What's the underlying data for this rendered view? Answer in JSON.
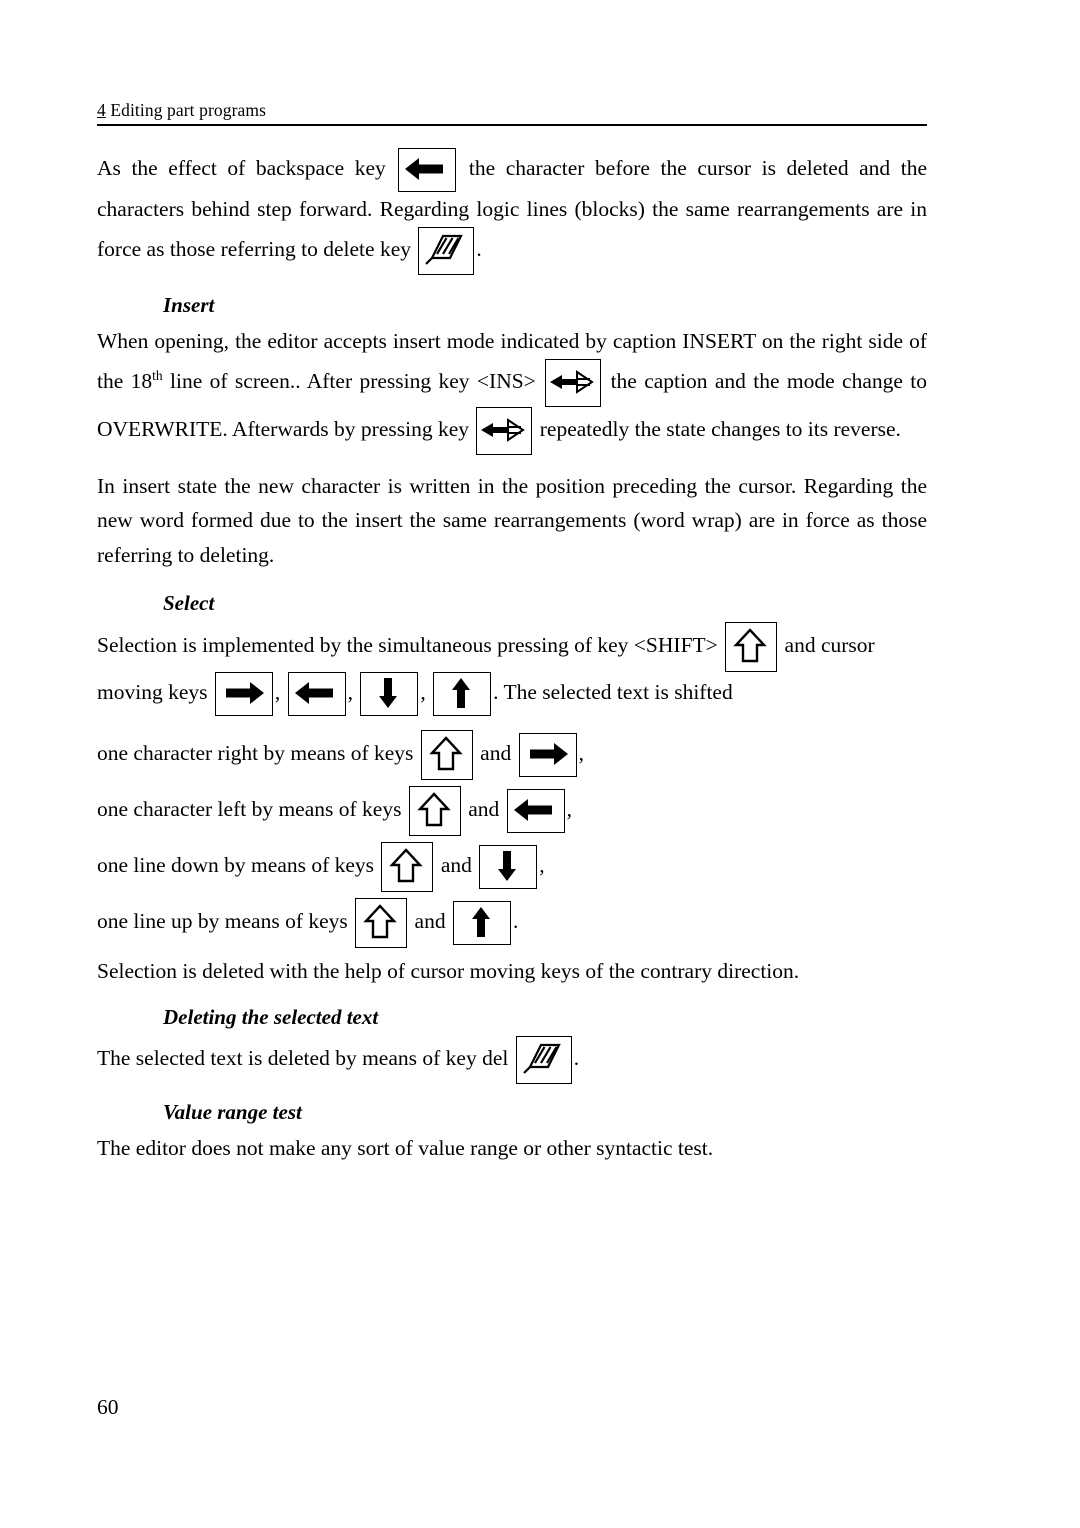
{
  "header": {
    "chapter_number": "4",
    "chapter_title": " Editing part programs"
  },
  "paragraphs": {
    "p1_a": "As the effect of backspace key",
    "p1_b": "the character before the cursor is deleted and the characters behind step forward. Regarding logic lines (blocks) the same rearrangements are in force as those referring to delete key",
    "p1_c": ".",
    "insert_heading": "Insert",
    "p2_a": "When opening, the editor accepts insert mode indicated by caption INSERT on the right side of the 18",
    "p2_sup": "th",
    "p2_b": " line of screen.. After pressing key <INS>",
    "p2_c": "the caption and the mode change to OVERWRITE. Afterwards by pressing key",
    "p2_d": "repeatedly the state changes to its reverse.",
    "p3": "In insert state the new character is written in the position preceding the cursor. Regarding the new word formed due to the insert the same rearrangements (word wrap) are in force as those referring to deleting.",
    "select_heading": "Select",
    "p4_a": "Selection is implemented by the simultaneous pressing of key <SHIFT>",
    "p4_b": "and cursor moving keys",
    "p4_comma1": ",",
    "p4_comma2": ",",
    "p4_comma3": ",",
    "p4_c": ". The selected text is shifted",
    "line_right_a": "one character right by means of keys",
    "line_right_and": "and",
    "line_right_end": ",",
    "line_left_a": "one character left by means of keys",
    "line_left_and": "and",
    "line_left_end": ",",
    "line_down_a": "one line down by means of keys",
    "line_down_and": "and",
    "line_down_end": ",",
    "line_up_a": "one line up by means of keys",
    "line_up_and": "and",
    "line_up_end": ".",
    "p5": "Selection is deleted with the help of cursor moving keys of the contrary direction.",
    "delsel_heading": "Deleting the selected text",
    "p6_a": "The selected text is deleted by means of key del",
    "p6_b": ".",
    "valrange_heading": "Value range test",
    "p7": "The editor does not make any sort of value range or other syntactic test."
  },
  "icons": {
    "backspace": "left-arrow-key-icon",
    "delete": "hatched-delete-key-icon",
    "ins": "insert-toggle-key-icon",
    "shift": "shift-up-arrow-key-icon",
    "right": "right-arrow-key-icon",
    "left": "left-arrow-key-icon",
    "down": "down-arrow-key-icon",
    "up": "up-arrow-key-icon"
  },
  "page_number": "60",
  "colors": {
    "text": "#000000",
    "background": "#ffffff"
  }
}
